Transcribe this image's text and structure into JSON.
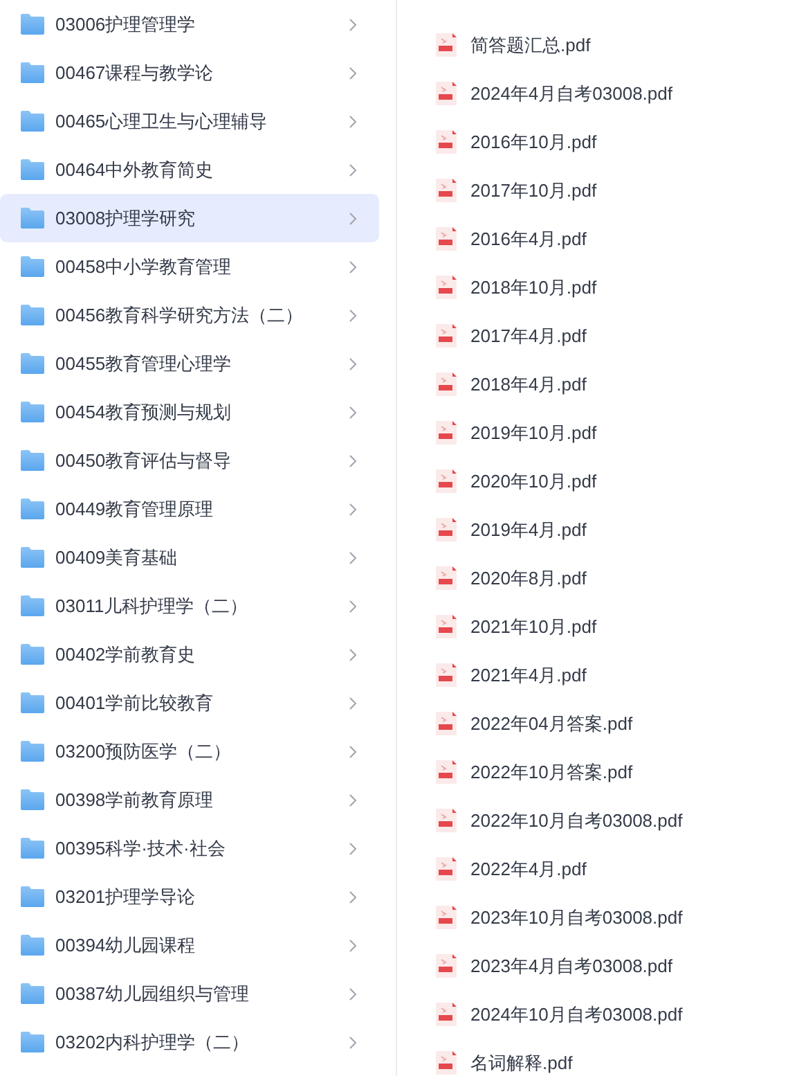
{
  "folders": [
    {
      "name": "03006护理管理学",
      "selected": false
    },
    {
      "name": "00467课程与教学论",
      "selected": false
    },
    {
      "name": "00465心理卫生与心理辅导",
      "selected": false
    },
    {
      "name": "00464中外教育简史",
      "selected": false
    },
    {
      "name": "03008护理学研究",
      "selected": true
    },
    {
      "name": "00458中小学教育管理",
      "selected": false
    },
    {
      "name": "00456教育科学研究方法（二）",
      "selected": false
    },
    {
      "name": "00455教育管理心理学",
      "selected": false
    },
    {
      "name": "00454教育预测与规划",
      "selected": false
    },
    {
      "name": "00450教育评估与督导",
      "selected": false
    },
    {
      "name": "00449教育管理原理",
      "selected": false
    },
    {
      "name": "00409美育基础",
      "selected": false
    },
    {
      "name": "03011儿科护理学（二）",
      "selected": false
    },
    {
      "name": "00402学前教育史",
      "selected": false
    },
    {
      "name": "00401学前比较教育",
      "selected": false
    },
    {
      "name": "03200预防医学（二）",
      "selected": false
    },
    {
      "name": "00398学前教育原理",
      "selected": false
    },
    {
      "name": "00395科学·技术·社会",
      "selected": false
    },
    {
      "name": "03201护理学导论",
      "selected": false
    },
    {
      "name": "00394幼儿园课程",
      "selected": false
    },
    {
      "name": "00387幼儿园组织与管理",
      "selected": false
    },
    {
      "name": "03202内科护理学（二）",
      "selected": false
    }
  ],
  "files": [
    "简答题汇总.pdf",
    "2024年4月自考03008.pdf",
    "2016年10月.pdf",
    "2017年10月.pdf",
    "2016年4月.pdf",
    "2018年10月.pdf",
    "2017年4月.pdf",
    "2018年4月.pdf",
    "2019年10月.pdf",
    "2020年10月.pdf",
    "2019年4月.pdf",
    "2020年8月.pdf",
    "2021年10月.pdf",
    "2021年4月.pdf",
    "2022年04月答案.pdf",
    "2022年10月答案.pdf",
    "2022年10月自考03008.pdf",
    "2022年4月.pdf",
    "2023年10月自考03008.pdf",
    "2023年4月自考03008.pdf",
    "2024年10月自考03008.pdf",
    "名词解释.pdf"
  ]
}
